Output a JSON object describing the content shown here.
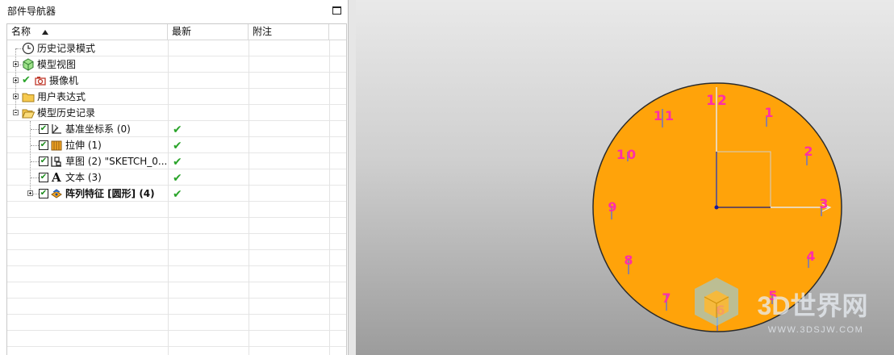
{
  "navigator": {
    "title": "部件导航器",
    "columns": {
      "name": "名称",
      "latest": "最新",
      "note": "附注"
    },
    "rows": [
      {
        "label": "历史记录模式",
        "icon": "clock-icon"
      },
      {
        "label": "模型视图",
        "icon": "model-view-icon"
      },
      {
        "label": "摄像机",
        "icon": "camera-icon"
      },
      {
        "label": "用户表达式",
        "icon": "folder-icon"
      },
      {
        "label": "模型历史记录",
        "icon": "folder-open-icon"
      },
      {
        "label": "基准坐标系 (0)",
        "icon": "datum-csys-icon",
        "latest": "✔"
      },
      {
        "label": "拉伸 (1)",
        "icon": "extrude-icon",
        "latest": "✔"
      },
      {
        "label": "草图 (2) \"SKETCH_0...",
        "icon": "sketch-icon",
        "latest": "✔"
      },
      {
        "label": "文本 (3)",
        "icon": "text-icon",
        "latest": "✔"
      },
      {
        "label": "阵列特征 [圆形] (4)",
        "icon": "pattern-feature-icon",
        "latest": "✔"
      }
    ]
  },
  "viewport": {
    "clock_numbers": [
      "12",
      "1",
      "2",
      "3",
      "4",
      "5",
      "6",
      "7",
      "8",
      "9",
      "10",
      "11"
    ],
    "watermark": {
      "brand": "3D世界网",
      "url": "WWW.3DSJW.COM"
    },
    "colors": {
      "dial": "#FFA30A",
      "numbers": "#FF2EA8",
      "background": "#CFCFCF"
    }
  }
}
